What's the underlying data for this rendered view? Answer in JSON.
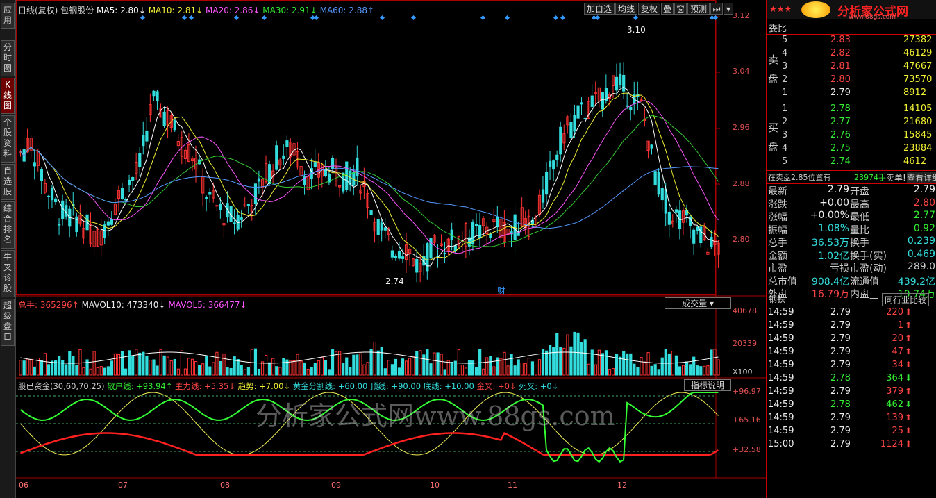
{
  "left_tabs": [
    "应用",
    "分时图",
    "K线图",
    "个股资料",
    "自选股",
    "综合排名",
    "牛叉诊股",
    "超级盘口"
  ],
  "kline_header": {
    "period": "日线(复权)",
    "stock": "包钢股份",
    "ma5": "MA5: 2.80↓",
    "ma10": "MA10: 2.81↓",
    "ma20": "MA20: 2.86↓",
    "ma30": "MA30: 2.91↓",
    "ma60": "MA60: 2.88↑"
  },
  "toolbar": {
    "add": "加自选",
    "ma": "均线",
    "adjust": "复权",
    "overlay": "叠",
    "window": "窗",
    "forecast": "预测",
    "nav": "⏭",
    "menu": "▾"
  },
  "price_axis": [
    "3.12",
    "3.04",
    "2.96",
    "2.88",
    "2.80"
  ],
  "annotations": {
    "high": "3.10",
    "low": "2.74",
    "cai": "财"
  },
  "volume_header": {
    "total": "总手: 365296↑",
    "mavol10": "MAVOL10: 473340↓",
    "mavol5": "MAVOL5: 366477↓",
    "selector": "成交量"
  },
  "volume_axis": [
    "40678",
    "20339",
    "X100"
  ],
  "indicator_header": {
    "name": "股已资金(30,60,70,25)",
    "sanhu": "散户线: +93.94↑",
    "zhuli": "主力线: +5.35↓",
    "qushi": "趋势: +7.00↓",
    "hj": "黄金分割线: +60.00",
    "top": "顶线: +90.00",
    "bottom": "底线: +10.00",
    "jincha": "金叉: +0↓",
    "sicha": "死叉: +0↓",
    "help": "指标说明"
  },
  "indicator_axis": [
    "+96.97",
    "+65.16",
    "+32.58"
  ],
  "months": [
    "06",
    "07",
    "08",
    "09",
    "10",
    "11",
    "12"
  ],
  "watermark": "分析家公式网www.88gs.com",
  "logo": {
    "text": "分析家公式网",
    "url": "www.88gs.com",
    "stars": "★★★"
  },
  "order_book": {
    "title": "委比",
    "sell_label": "卖盘",
    "buy_label": "买盘",
    "sell": [
      {
        "n": "5",
        "p": "2.83",
        "v": "27382"
      },
      {
        "n": "4",
        "p": "2.82",
        "v": "46129"
      },
      {
        "n": "3",
        "p": "2.81",
        "v": "47667"
      },
      {
        "n": "2",
        "p": "2.80",
        "v": "73570"
      },
      {
        "n": "1",
        "p": "2.79",
        "v": "8912"
      }
    ],
    "buy": [
      {
        "n": "1",
        "p": "2.78",
        "v": "14105"
      },
      {
        "n": "2",
        "p": "2.77",
        "v": "21680"
      },
      {
        "n": "3",
        "p": "2.76",
        "v": "15845"
      },
      {
        "n": "4",
        "p": "2.75",
        "v": "23884"
      },
      {
        "n": "5",
        "p": "2.74",
        "v": "4612"
      }
    ]
  },
  "order_notice": {
    "text": "在卖盘2.85位置有",
    "qty": "23974手",
    "tail": "卖单!",
    "detail": "查看详细"
  },
  "quote": [
    {
      "l1": "最新",
      "v1": "2.79",
      "c1": "white",
      "l2": "开盘",
      "v2": "2.79",
      "c2": "white"
    },
    {
      "l1": "涨跌",
      "v1": "+0.00",
      "c1": "white",
      "l2": "最高",
      "v2": "2.80",
      "c2": "red"
    },
    {
      "l1": "涨幅",
      "v1": "+0.00%",
      "c1": "white",
      "l2": "最低",
      "v2": "2.77",
      "c2": "green"
    },
    {
      "l1": "振幅",
      "v1": "1.08%",
      "c1": "cyan",
      "l2": "量比",
      "v2": "0.92",
      "c2": "green"
    },
    {
      "l1": "总手",
      "v1": "36.53万",
      "c1": "cyan",
      "l2": "换手",
      "v2": "0.239",
      "c2": "cyan"
    },
    {
      "l1": "金额",
      "v1": "1.02亿",
      "c1": "cyan",
      "l2": "换手(实)",
      "v2": "0.469",
      "c2": "cyan"
    },
    {
      "l1": "市盈",
      "v1": "亏损",
      "c1": "gray",
      "l2": "市盈(动)",
      "v2": "289.0",
      "c2": "gray"
    },
    {
      "l1": "总市值",
      "v1": "908.4亿",
      "c1": "cyan",
      "l2": "流通值",
      "v2": "439.2亿",
      "c2": "cyan"
    },
    {
      "l1": "外盘",
      "v1": "16.79万",
      "c1": "red",
      "l2": "内盘",
      "v2": "19.74万",
      "c2": "green"
    }
  ],
  "sector": {
    "name": "钢铁",
    "dash": "—",
    "compare": "同行业比较"
  },
  "ticks": [
    {
      "t": "14:59",
      "p": "2.79",
      "pc": "white",
      "v": "220",
      "vc": "red",
      "d": "up"
    },
    {
      "t": "14:59",
      "p": "2.79",
      "pc": "white",
      "v": "1",
      "vc": "red",
      "d": "up"
    },
    {
      "t": "14:59",
      "p": "2.79",
      "pc": "white",
      "v": "20",
      "vc": "red",
      "d": "up"
    },
    {
      "t": "14:59",
      "p": "2.79",
      "pc": "white",
      "v": "47",
      "vc": "red",
      "d": "up"
    },
    {
      "t": "14:59",
      "p": "2.79",
      "pc": "white",
      "v": "34",
      "vc": "red",
      "d": "up"
    },
    {
      "t": "14:59",
      "p": "2.78",
      "pc": "green",
      "v": "364",
      "vc": "green",
      "d": "down"
    },
    {
      "t": "14:59",
      "p": "2.79",
      "pc": "white",
      "v": "379",
      "vc": "red",
      "d": "up"
    },
    {
      "t": "14:59",
      "p": "2.78",
      "pc": "green",
      "v": "462",
      "vc": "green",
      "d": "down"
    },
    {
      "t": "14:59",
      "p": "2.79",
      "pc": "white",
      "v": "139",
      "vc": "red",
      "d": "up"
    },
    {
      "t": "14:59",
      "p": "2.79",
      "pc": "white",
      "v": "25",
      "vc": "red",
      "d": "up"
    },
    {
      "t": "15:00",
      "p": "2.79",
      "pc": "white",
      "v": "1124",
      "vc": "red",
      "d": "up"
    }
  ],
  "colors": {
    "up": "#ff3333",
    "down": "#33dddd",
    "ma5": "#ffffff",
    "ma10": "#eeee33",
    "ma20": "#ff55ff",
    "ma30": "#33cc33",
    "ma60": "#5599ff",
    "sanhu": "#33ff33",
    "zhuli": "#ff2020",
    "qushi": "#eeee55"
  }
}
